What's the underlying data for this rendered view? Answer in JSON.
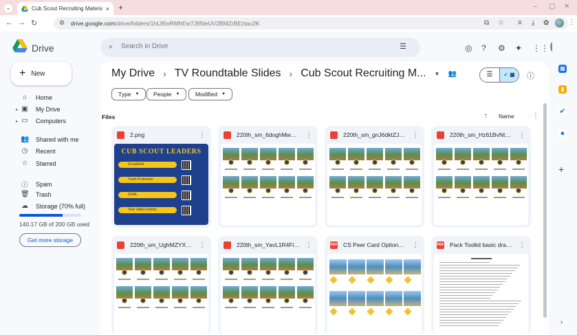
{
  "browser": {
    "tab_title": "Cub Scout Recruiting Materials",
    "tab_close": "×",
    "new_tab": "+",
    "url_host": "drive.google.com",
    "url_path": "/drive/folders/1hL95vRMfrEw7J95teUV2BMZrBEztau2K"
  },
  "app": {
    "name": "Drive",
    "search_placeholder": "Search in Drive"
  },
  "sidebar": {
    "new_label": "New",
    "items": [
      {
        "label": "Home",
        "icon": "home-icon"
      },
      {
        "label": "My Drive",
        "icon": "my-drive-icon"
      },
      {
        "label": "Computers",
        "icon": "computers-icon"
      },
      {
        "label": "Shared with me",
        "icon": "shared-icon"
      },
      {
        "label": "Recent",
        "icon": "clock-icon"
      },
      {
        "label": "Starred",
        "icon": "star-icon"
      },
      {
        "label": "Spam",
        "icon": "spam-icon"
      },
      {
        "label": "Trash",
        "icon": "trash-icon"
      },
      {
        "label": "Storage (70% full)",
        "icon": "cloud-icon"
      }
    ],
    "storage_used_fraction": 0.7,
    "storage_text": "140.17 GB of 200 GB used",
    "get_storage": "Get more storage"
  },
  "breadcrumb": {
    "root": "My Drive",
    "parent": "TV Roundtable Slides",
    "current": "Cub Scout Recruiting M..."
  },
  "filters": {
    "type": "Type",
    "people": "People",
    "modified": "Modified"
  },
  "files": {
    "section_label": "Files",
    "sort_label": "Name",
    "items": [
      {
        "name": "2.png",
        "type": "image",
        "badge": ""
      },
      {
        "name": "220th_sm_6doghMwwlj...",
        "type": "image",
        "badge": ""
      },
      {
        "name": "220th_sm_gnJ6dktZJ8l...",
        "type": "image",
        "badge": ""
      },
      {
        "name": "220th_sm_Hz61BvNt7J...",
        "type": "image",
        "badge": ""
      },
      {
        "name": "220th_sm_UghMZYXqe...",
        "type": "image",
        "badge": ""
      },
      {
        "name": "220th_sm_YavL1R4Fi61...",
        "type": "image",
        "badge": ""
      },
      {
        "name": "CS Peer Card Options....",
        "type": "pdf",
        "badge": "PDF"
      },
      {
        "name": "Pack Toolkit basic draft...",
        "type": "pdf",
        "badge": "PDF"
      }
    ]
  },
  "thumb_cubscout": {
    "title": "CUB SCOUT LEADERS",
    "pills": [
      "Scoutbook",
      "Youth Protection",
      "GOAL",
      "Twin Valley District"
    ]
  },
  "colors": {
    "accent": "#0b57d0",
    "selected_toggle": "#c2e7ff",
    "pdf_red": "#e94235",
    "scout_blue": "#1f3f8f",
    "scout_gold": "#f5c518"
  }
}
